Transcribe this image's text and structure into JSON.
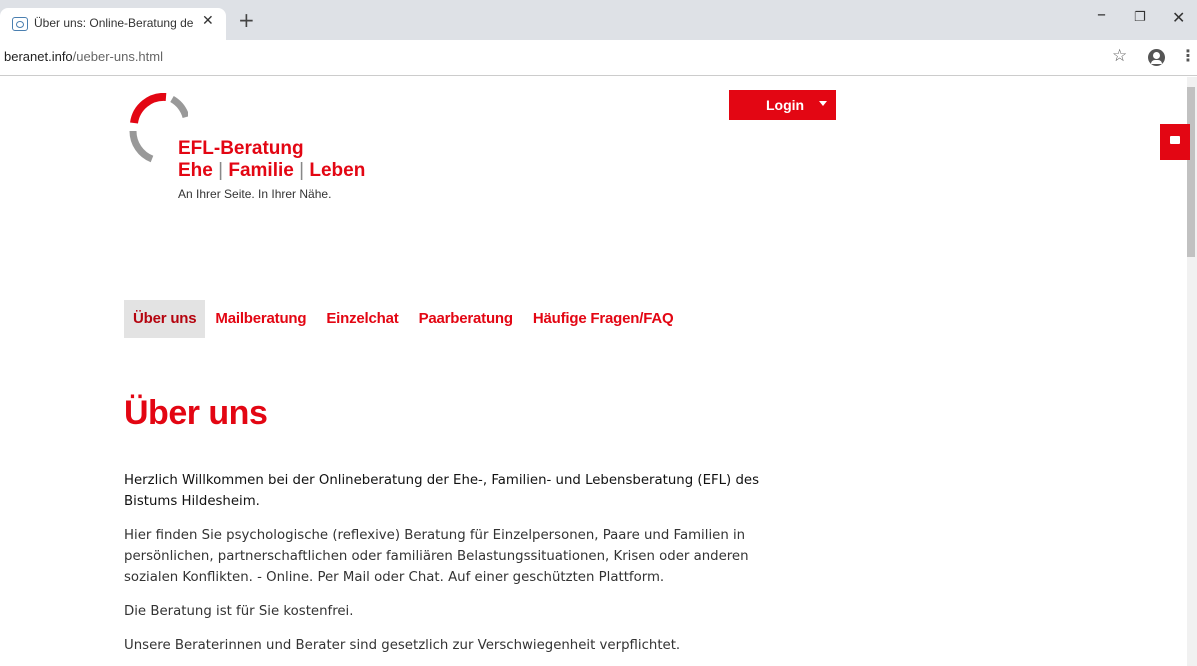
{
  "browser": {
    "tab_title": "Über uns: Online-Beratung der E",
    "tab_close": "✕",
    "new_tab": "+",
    "url_host": "beranet.info",
    "url_path": "/ueber-uns.html",
    "window_controls": {
      "minimize": "–",
      "maximize": "❐",
      "close": "✕"
    }
  },
  "header": {
    "logo_line1": "EFL-Beratung",
    "logo_line2_part1": "Ehe",
    "logo_line2_sep": "|",
    "logo_line2_part2": "Familie",
    "logo_line2_part3": "Leben",
    "logo_tagline": "An Ihrer Seite. In Ihrer Nähe.",
    "login_label": "Login"
  },
  "nav": {
    "items": [
      {
        "label": "Über uns"
      },
      {
        "label": "Mailberatung"
      },
      {
        "label": "Einzelchat"
      },
      {
        "label": "Paarberatung"
      },
      {
        "label": "Häufige Fragen/FAQ"
      }
    ]
  },
  "main": {
    "title": "Über uns",
    "paragraphs": [
      "Herzlich Willkommen bei der Onlineberatung der Ehe-, Familien- und Lebensberatung (EFL) des Bistums Hildesheim.",
      "Hier finden Sie psychologische (reflexive) Beratung für Einzelpersonen, Paare und Familien in persönlichen, partnerschaftlichen oder familiären Belastungssituationen, Krisen oder anderen sozialen Konflikten. - Online. Per Mail oder Chat. Auf einer geschützten Plattform.",
      "Die Beratung ist für Sie kostenfrei.",
      "Unsere Beraterinnen und Berater sind gesetzlich zur Verschwiegenheit verpflichtet."
    ]
  },
  "colors": {
    "accent": "#e30613",
    "logo_gray": "#999999"
  },
  "icons": [
    "favicon-icon",
    "close-icon",
    "plus-icon",
    "star-icon",
    "account-icon",
    "menu-icon",
    "chat-icon",
    "caret-down-icon"
  ]
}
